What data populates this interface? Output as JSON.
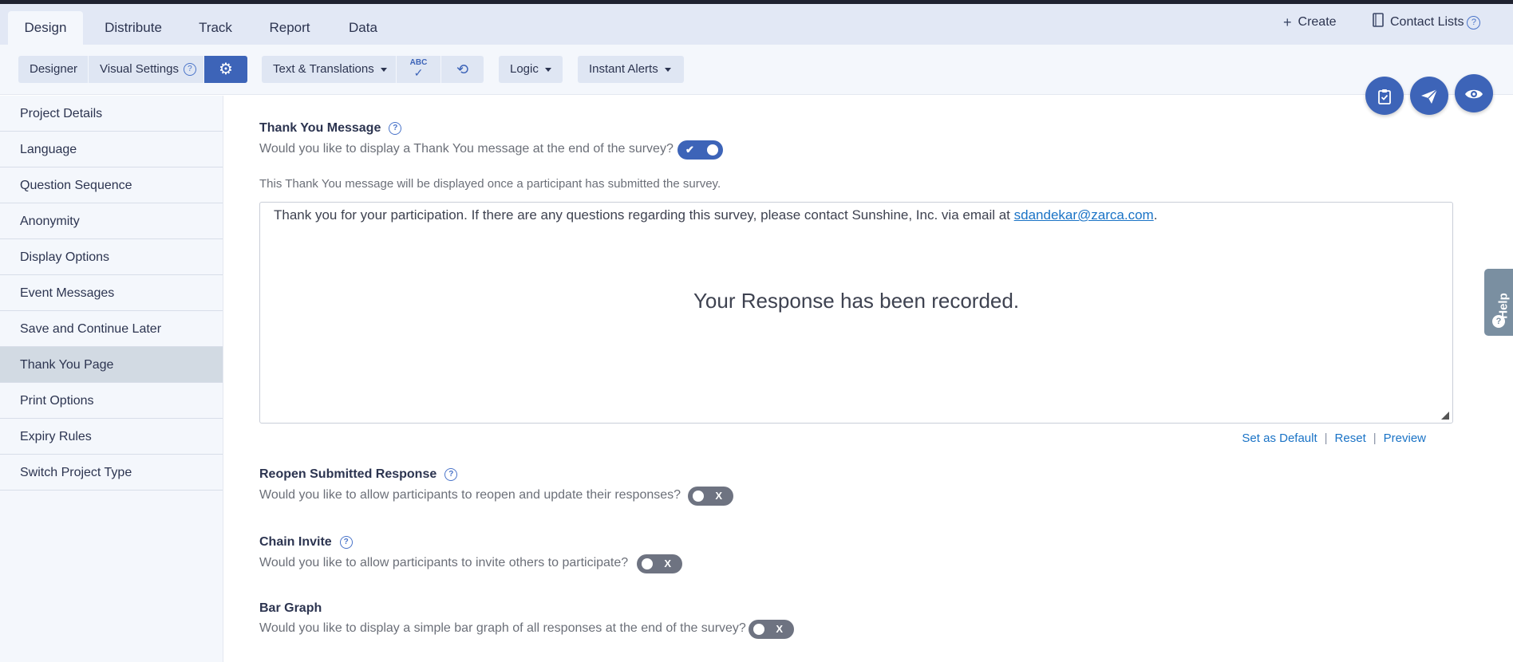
{
  "tabs": [
    {
      "label": "Design",
      "active": true
    },
    {
      "label": "Distribute"
    },
    {
      "label": "Track"
    },
    {
      "label": "Report"
    },
    {
      "label": "Data"
    }
  ],
  "top_right": {
    "create_label": "Create",
    "create_icon": "plus-icon",
    "contact_label": "Contact Lists",
    "contact_icon": "address-book-icon"
  },
  "toolbar": {
    "designer_label": "Designer",
    "visual_label": "Visual Settings",
    "gear_icon": "gear-icon",
    "text_label": "Text & Translations",
    "abc_label": "ABC",
    "spellcheck_icon": "spellcheck-icon",
    "refresh_icon": "find-replace-icon",
    "logic_label": "Logic",
    "alerts_label": "Instant Alerts"
  },
  "fabs": [
    "checklist-icon",
    "send-icon",
    "eye-icon"
  ],
  "sidebar": {
    "items": [
      {
        "label": "Project Details"
      },
      {
        "label": "Language"
      },
      {
        "label": "Question Sequence"
      },
      {
        "label": "Anonymity"
      },
      {
        "label": "Display Options"
      },
      {
        "label": "Event Messages"
      },
      {
        "label": "Save and Continue Later"
      },
      {
        "label": "Thank You Page",
        "active": true
      },
      {
        "label": "Print Options"
      },
      {
        "label": "Expiry Rules"
      },
      {
        "label": "Switch Project Type"
      }
    ]
  },
  "thank_you": {
    "title": "Thank You Message",
    "question": "Would you like to display a Thank You message at the end of the survey?",
    "enabled": true,
    "note": "This Thank You message will be displayed once a participant has submitted the survey.",
    "message_text": "Thank you for your participation. If there are any questions regarding this survey, please contact Sunshine, Inc. via email at ",
    "message_email": "sdandekar@zarca.com",
    "message_end": ".",
    "message_big": "Your Response has been recorded.",
    "actions": {
      "set_default": "Set as Default",
      "reset": "Reset",
      "preview": "Preview",
      "sep": "|"
    }
  },
  "reopen": {
    "title": "Reopen Submitted Response",
    "question": "Would you like to allow participants to reopen and update their responses?",
    "enabled": false
  },
  "chain": {
    "title": "Chain Invite",
    "question": "Would you like to allow participants to invite others to participate?",
    "enabled": false
  },
  "bar_graph": {
    "title": "Bar Graph",
    "question": "Would you like to display a simple bar graph of all responses at the end of the survey?",
    "enabled": false
  },
  "help_tab": {
    "label": "Help"
  },
  "colors": {
    "accent": "#3d64b8",
    "toggle_off": "#6e7381",
    "active_side": "#d2dae3"
  }
}
